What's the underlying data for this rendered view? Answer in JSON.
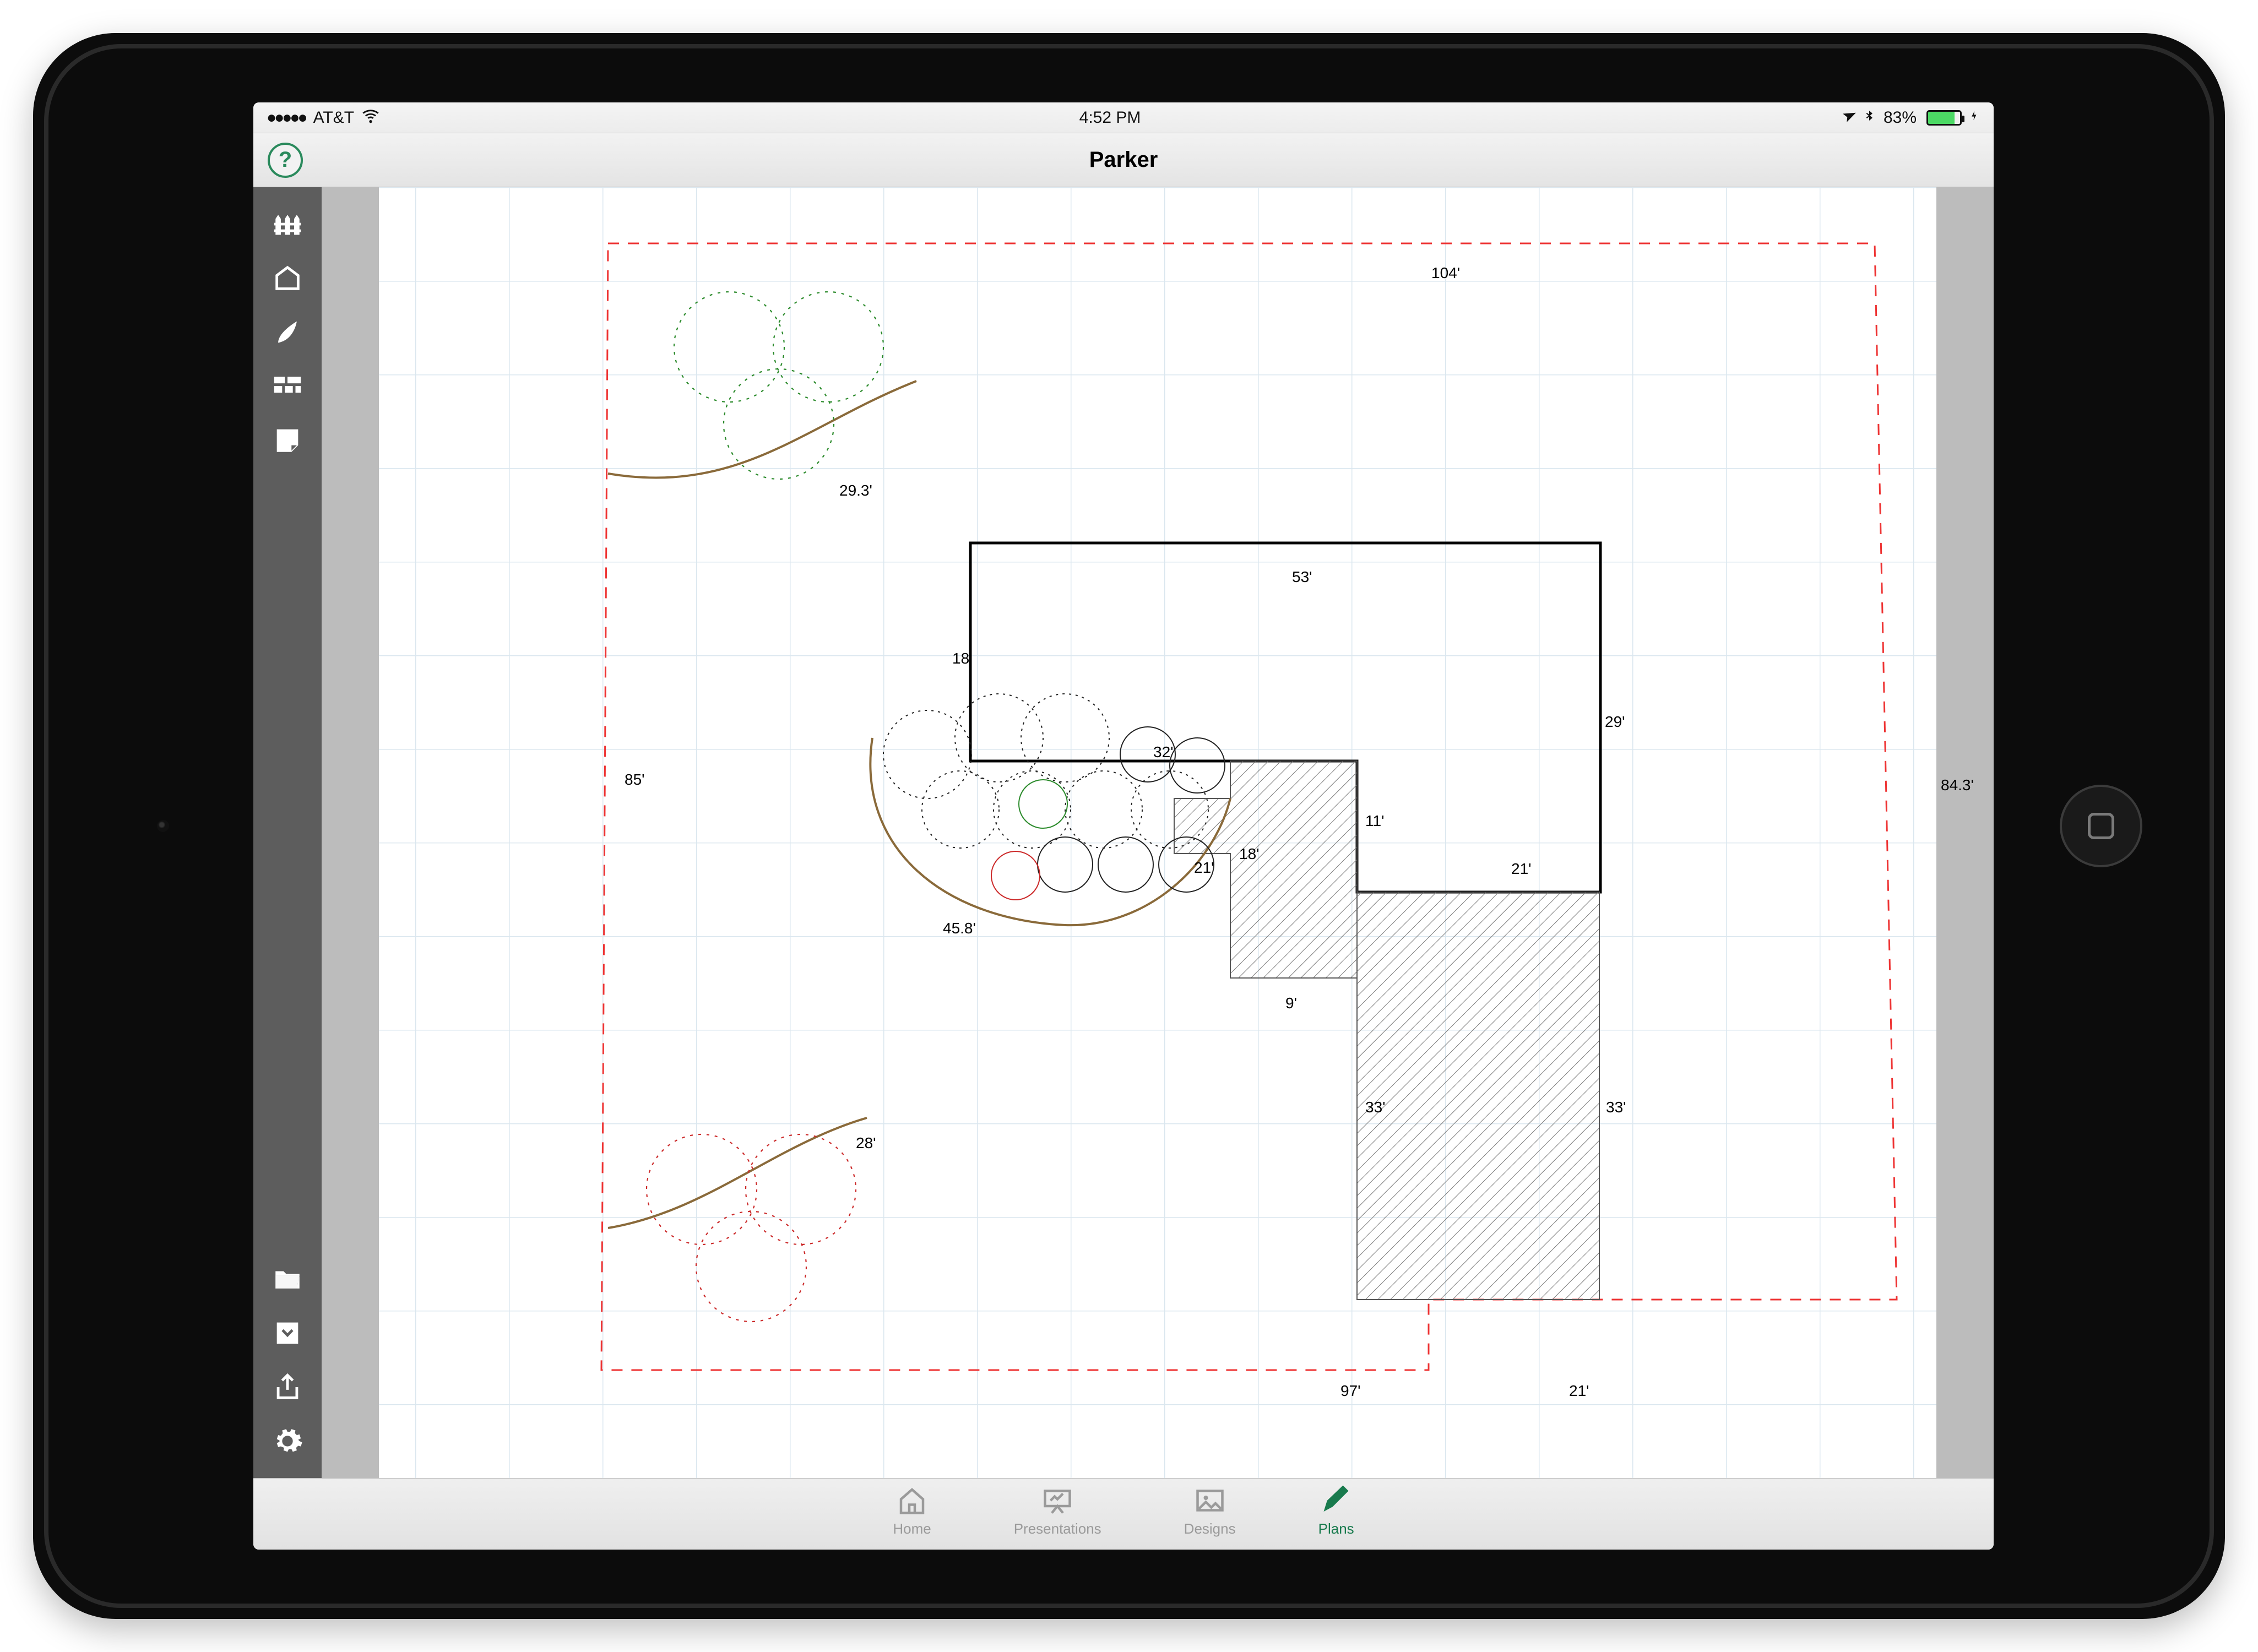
{
  "status": {
    "signal_dots": "●●●●●",
    "carrier": "AT&T",
    "time": "4:52 PM",
    "location_arrow": "➤",
    "bluetooth": "✱",
    "battery_pct": "83%",
    "charging": "⚡"
  },
  "title": "Parker",
  "help_label": "?",
  "tabs": {
    "home": "Home",
    "presentations": "Presentations",
    "designs": "Designs",
    "plans": "Plans",
    "active": "plans"
  },
  "plan": {
    "boundary": {
      "top": "104'",
      "right": "84.3'",
      "left": "85'",
      "bottom_left": "97'",
      "bottom_right": "21'"
    },
    "bed_curves": {
      "top_left": "29.3'",
      "bottom_left": "28'",
      "center": "45.8'"
    },
    "house": {
      "top": "53'",
      "left_v": "18'",
      "right_v": "29'",
      "step_h": "32'",
      "step_v": "11'",
      "inner_left_v": "18'",
      "porch_below": "9'",
      "porch_right": "21'",
      "hardscape_right_h": "21'",
      "hardscape_left_v": "33'",
      "hardscape_right_v": "33'"
    }
  }
}
